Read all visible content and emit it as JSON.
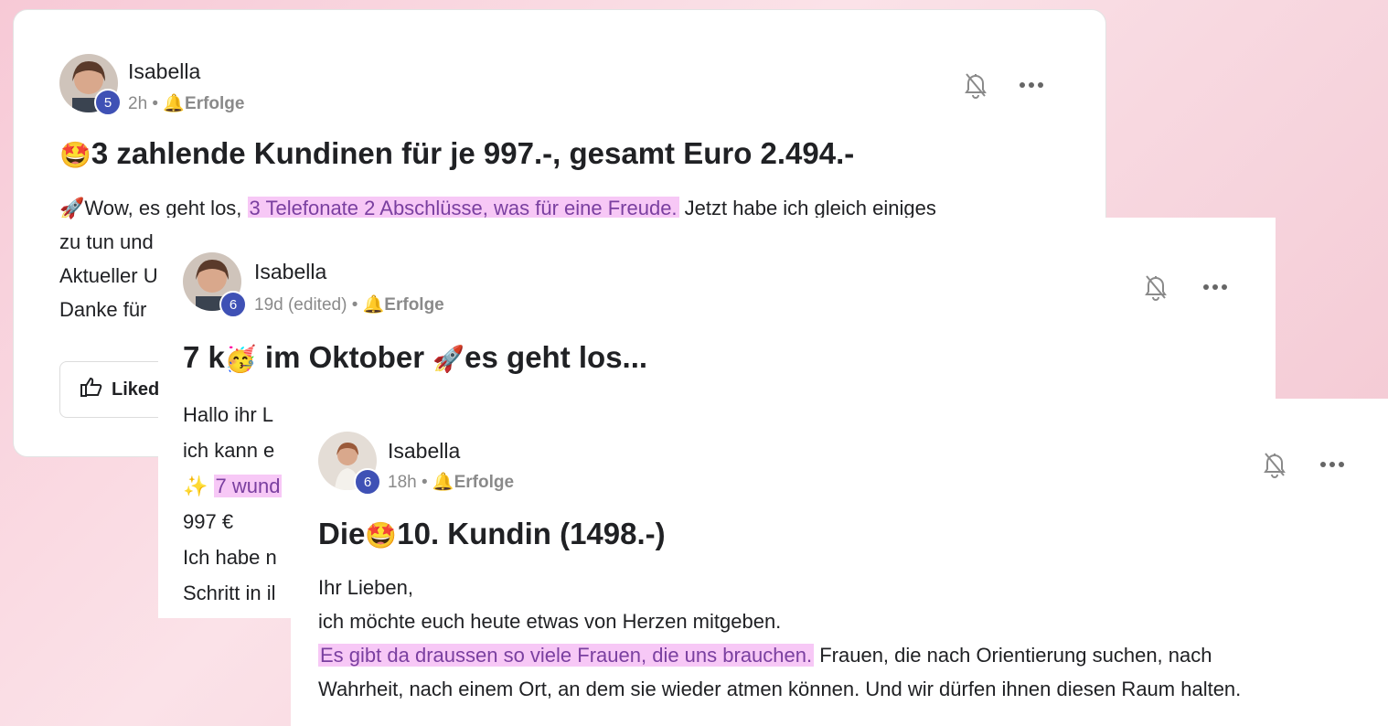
{
  "posts": [
    {
      "author": "Isabella",
      "level": "5",
      "time": "2h",
      "sep": "•",
      "category": "Erfolge",
      "title_emoji": "🤩",
      "title": "3 zahlende Kundinen für je 997.-, gesamt Euro 2.494.-",
      "body": {
        "l1_emoji": "🚀",
        "l1_pre": "Wow, es geht los, ",
        "l1_hl": "3 Telefonate 2 Abschlüsse, was für eine Freude.",
        "l1_post": " Jetzt habe ich gleich einiges",
        "l2": "zu tun und",
        "l3": "Aktueller U",
        "l4": "Danke für"
      },
      "like_label": "Liked"
    },
    {
      "author": "Isabella",
      "level": "6",
      "time": "19d (edited)",
      "sep": "•",
      "category": "Erfolge",
      "title_a": "7 k",
      "title_emoji1": "🥳",
      "title_b": " im Oktober ",
      "title_emoji2": "🚀",
      "title_c": "es geht los...",
      "body": {
        "l1": "Hallo ihr L",
        "l2": "ich kann e",
        "l3_emoji": "✨",
        "l3_hl": "7 wund",
        "l4": "997 €",
        "l5": "Ich habe n",
        "l6": "Schritt in il"
      }
    },
    {
      "author": "Isabella",
      "level": "6",
      "time": "18h",
      "sep": "•",
      "category": "Erfolge",
      "title_a": "Die",
      "title_emoji": "🤩",
      "title_b": "10. Kundin (1498.-)",
      "body": {
        "l1": "Ihr Lieben,",
        "l2": "ich möchte euch heute etwas von Herzen mitgeben.",
        "l3_hl": "Es gibt da draussen so viele Frauen, die uns brauchen.",
        "l3_post": " Frauen, die nach Orientierung suchen, nach",
        "l4": "Wahrheit, nach einem Ort, an dem sie wieder atmen können. Und wir dürfen ihnen diesen Raum halten."
      }
    }
  ],
  "icons": {
    "bell": "bell-off-icon",
    "more": "more-icon",
    "bell_small": "bell-icon",
    "thumb": "thumbs-up-icon"
  },
  "colors": {
    "level_badge": "#3f51b5",
    "highlight_bg": "#f7c8f6",
    "highlight_text": "#7a3fa0"
  }
}
